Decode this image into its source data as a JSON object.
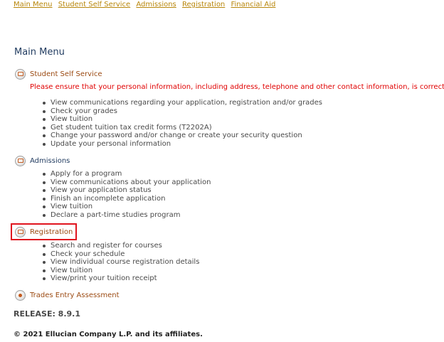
{
  "top_nav": [
    "Main Menu",
    "Student Self Service",
    "Admissions",
    "Registration",
    "Financial Aid"
  ],
  "page_title": "Main Menu",
  "sections": {
    "student_self_service": {
      "title": "Student Self Service",
      "notice": "Please ensure that your personal information, including address, telephone and other contact information, is correct.",
      "items": [
        "View communications regarding your application, registration and/or grades",
        "Check your grades",
        "View tuition",
        "Get student tuition tax credit forms (T2202A)",
        "Change your password and/or change or create your security question",
        "Update your personal information"
      ]
    },
    "admissions": {
      "title": "Admissions",
      "items": [
        "Apply for a program",
        "View communications about your application",
        "View your application status",
        "Finish an incomplete application",
        "View tuition",
        "Declare a part-time studies program"
      ]
    },
    "registration": {
      "title": "Registration",
      "items": [
        "Search and register for courses",
        "Check your schedule",
        "View individual course registration details",
        "View tuition",
        "View/print your tuition receipt"
      ]
    },
    "trades_entry": {
      "title": "Trades Entry Assessment"
    }
  },
  "release": "RELEASE: 8.9.1",
  "copyright": "© 2021 Ellucian Company L.P. and its affiliates.",
  "colors": {
    "nav_link": "#b8860b",
    "section_link": "#9b4a12",
    "notice": "#e00000",
    "highlight": "#e0141e"
  }
}
